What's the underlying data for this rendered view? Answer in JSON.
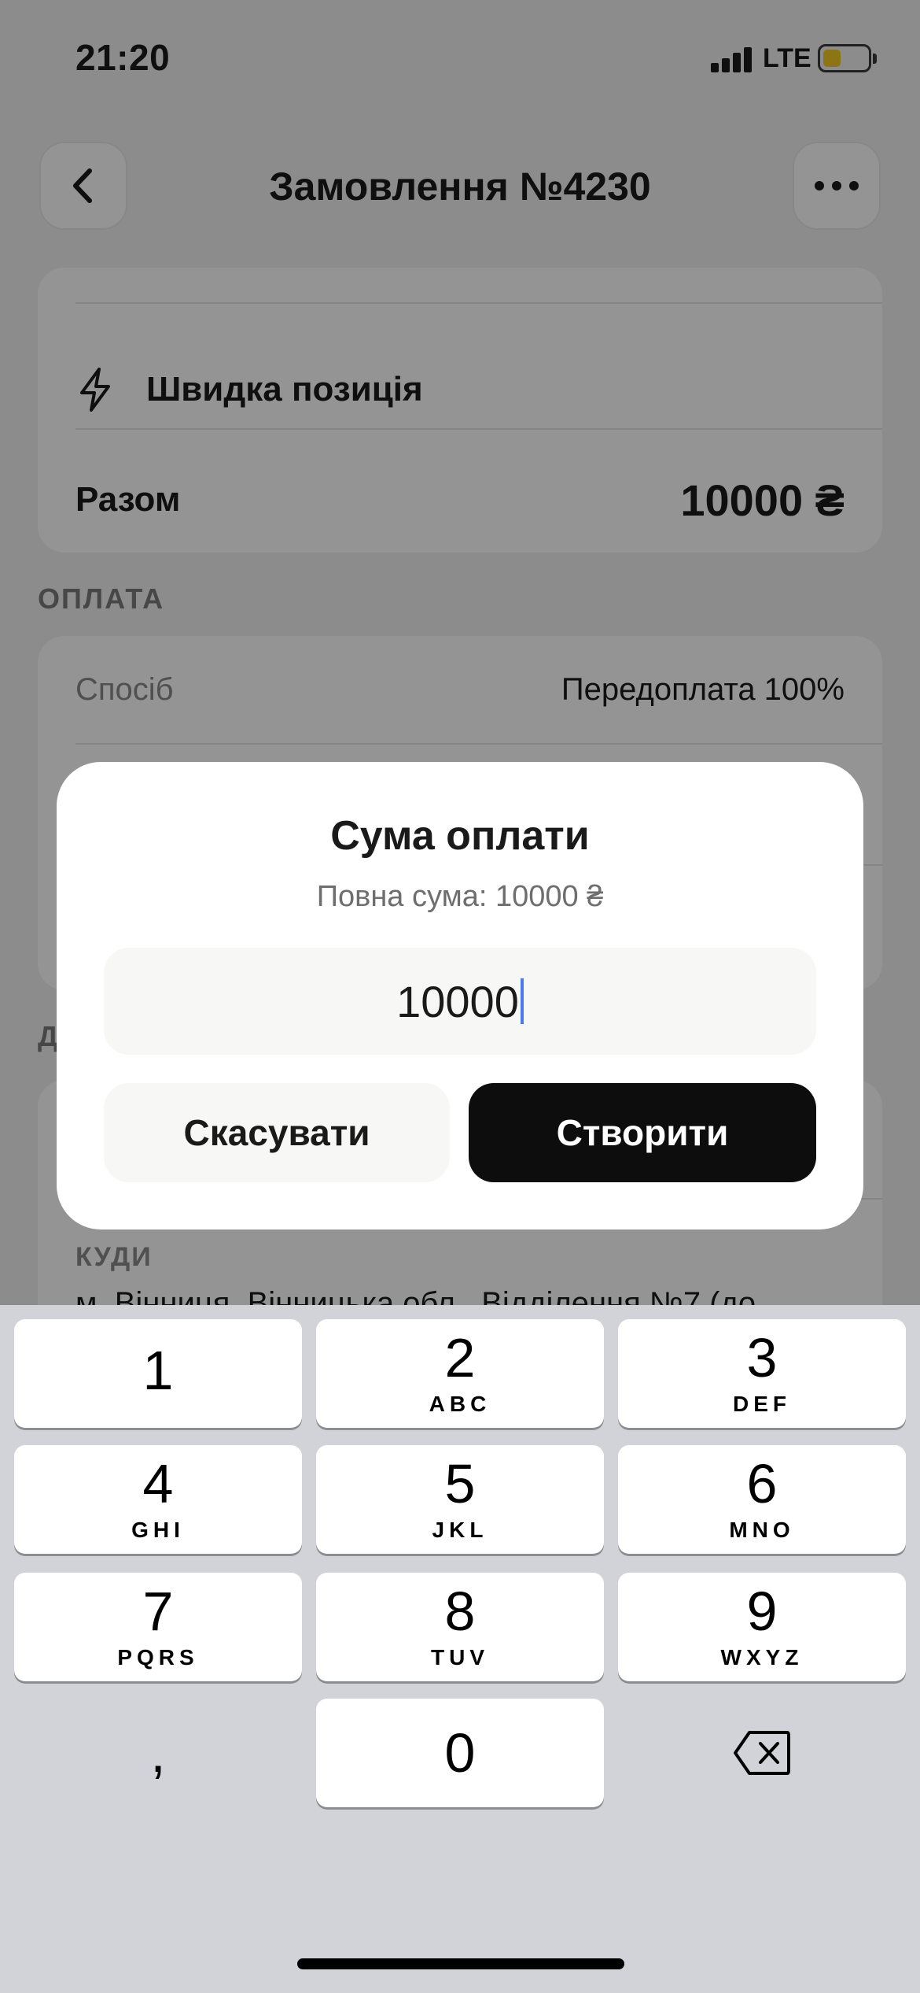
{
  "status_bar": {
    "time": "21:20",
    "network": "LTE"
  },
  "header": {
    "title": "Замовлення №4230"
  },
  "items": {
    "quick_position": "Швидка позиція",
    "total_label": "Разом",
    "total_value": "10000 ₴"
  },
  "payment": {
    "section_title": "ОПЛАТА",
    "method_label": "Спосіб",
    "method_value": "Передоплата 100%"
  },
  "delivery": {
    "section_title": "Д",
    "destination_label": "КУДИ",
    "destination_value": "м. Вінниця, Вінницька обл., Відділення №7 (до"
  },
  "dialog": {
    "title": "Сума оплати",
    "subtitle": "Повна сума: 10000 ₴",
    "amount": "10000",
    "cancel_label": "Скасувати",
    "create_label": "Створити"
  },
  "keyboard": {
    "keys": [
      {
        "digit": "1",
        "letters": ""
      },
      {
        "digit": "2",
        "letters": "ABC"
      },
      {
        "digit": "3",
        "letters": "DEF"
      },
      {
        "digit": "4",
        "letters": "GHI"
      },
      {
        "digit": "5",
        "letters": "JKL"
      },
      {
        "digit": "6",
        "letters": "MNO"
      },
      {
        "digit": "7",
        "letters": "PQRS"
      },
      {
        "digit": "8",
        "letters": "TUV"
      },
      {
        "digit": "9",
        "letters": "WXYZ"
      },
      {
        "digit": "0",
        "letters": ""
      }
    ],
    "decimal": ","
  },
  "colors": {
    "primary_button": "#0d0d0d",
    "battery": "#f5c400",
    "caret": "#4a7cf0"
  }
}
